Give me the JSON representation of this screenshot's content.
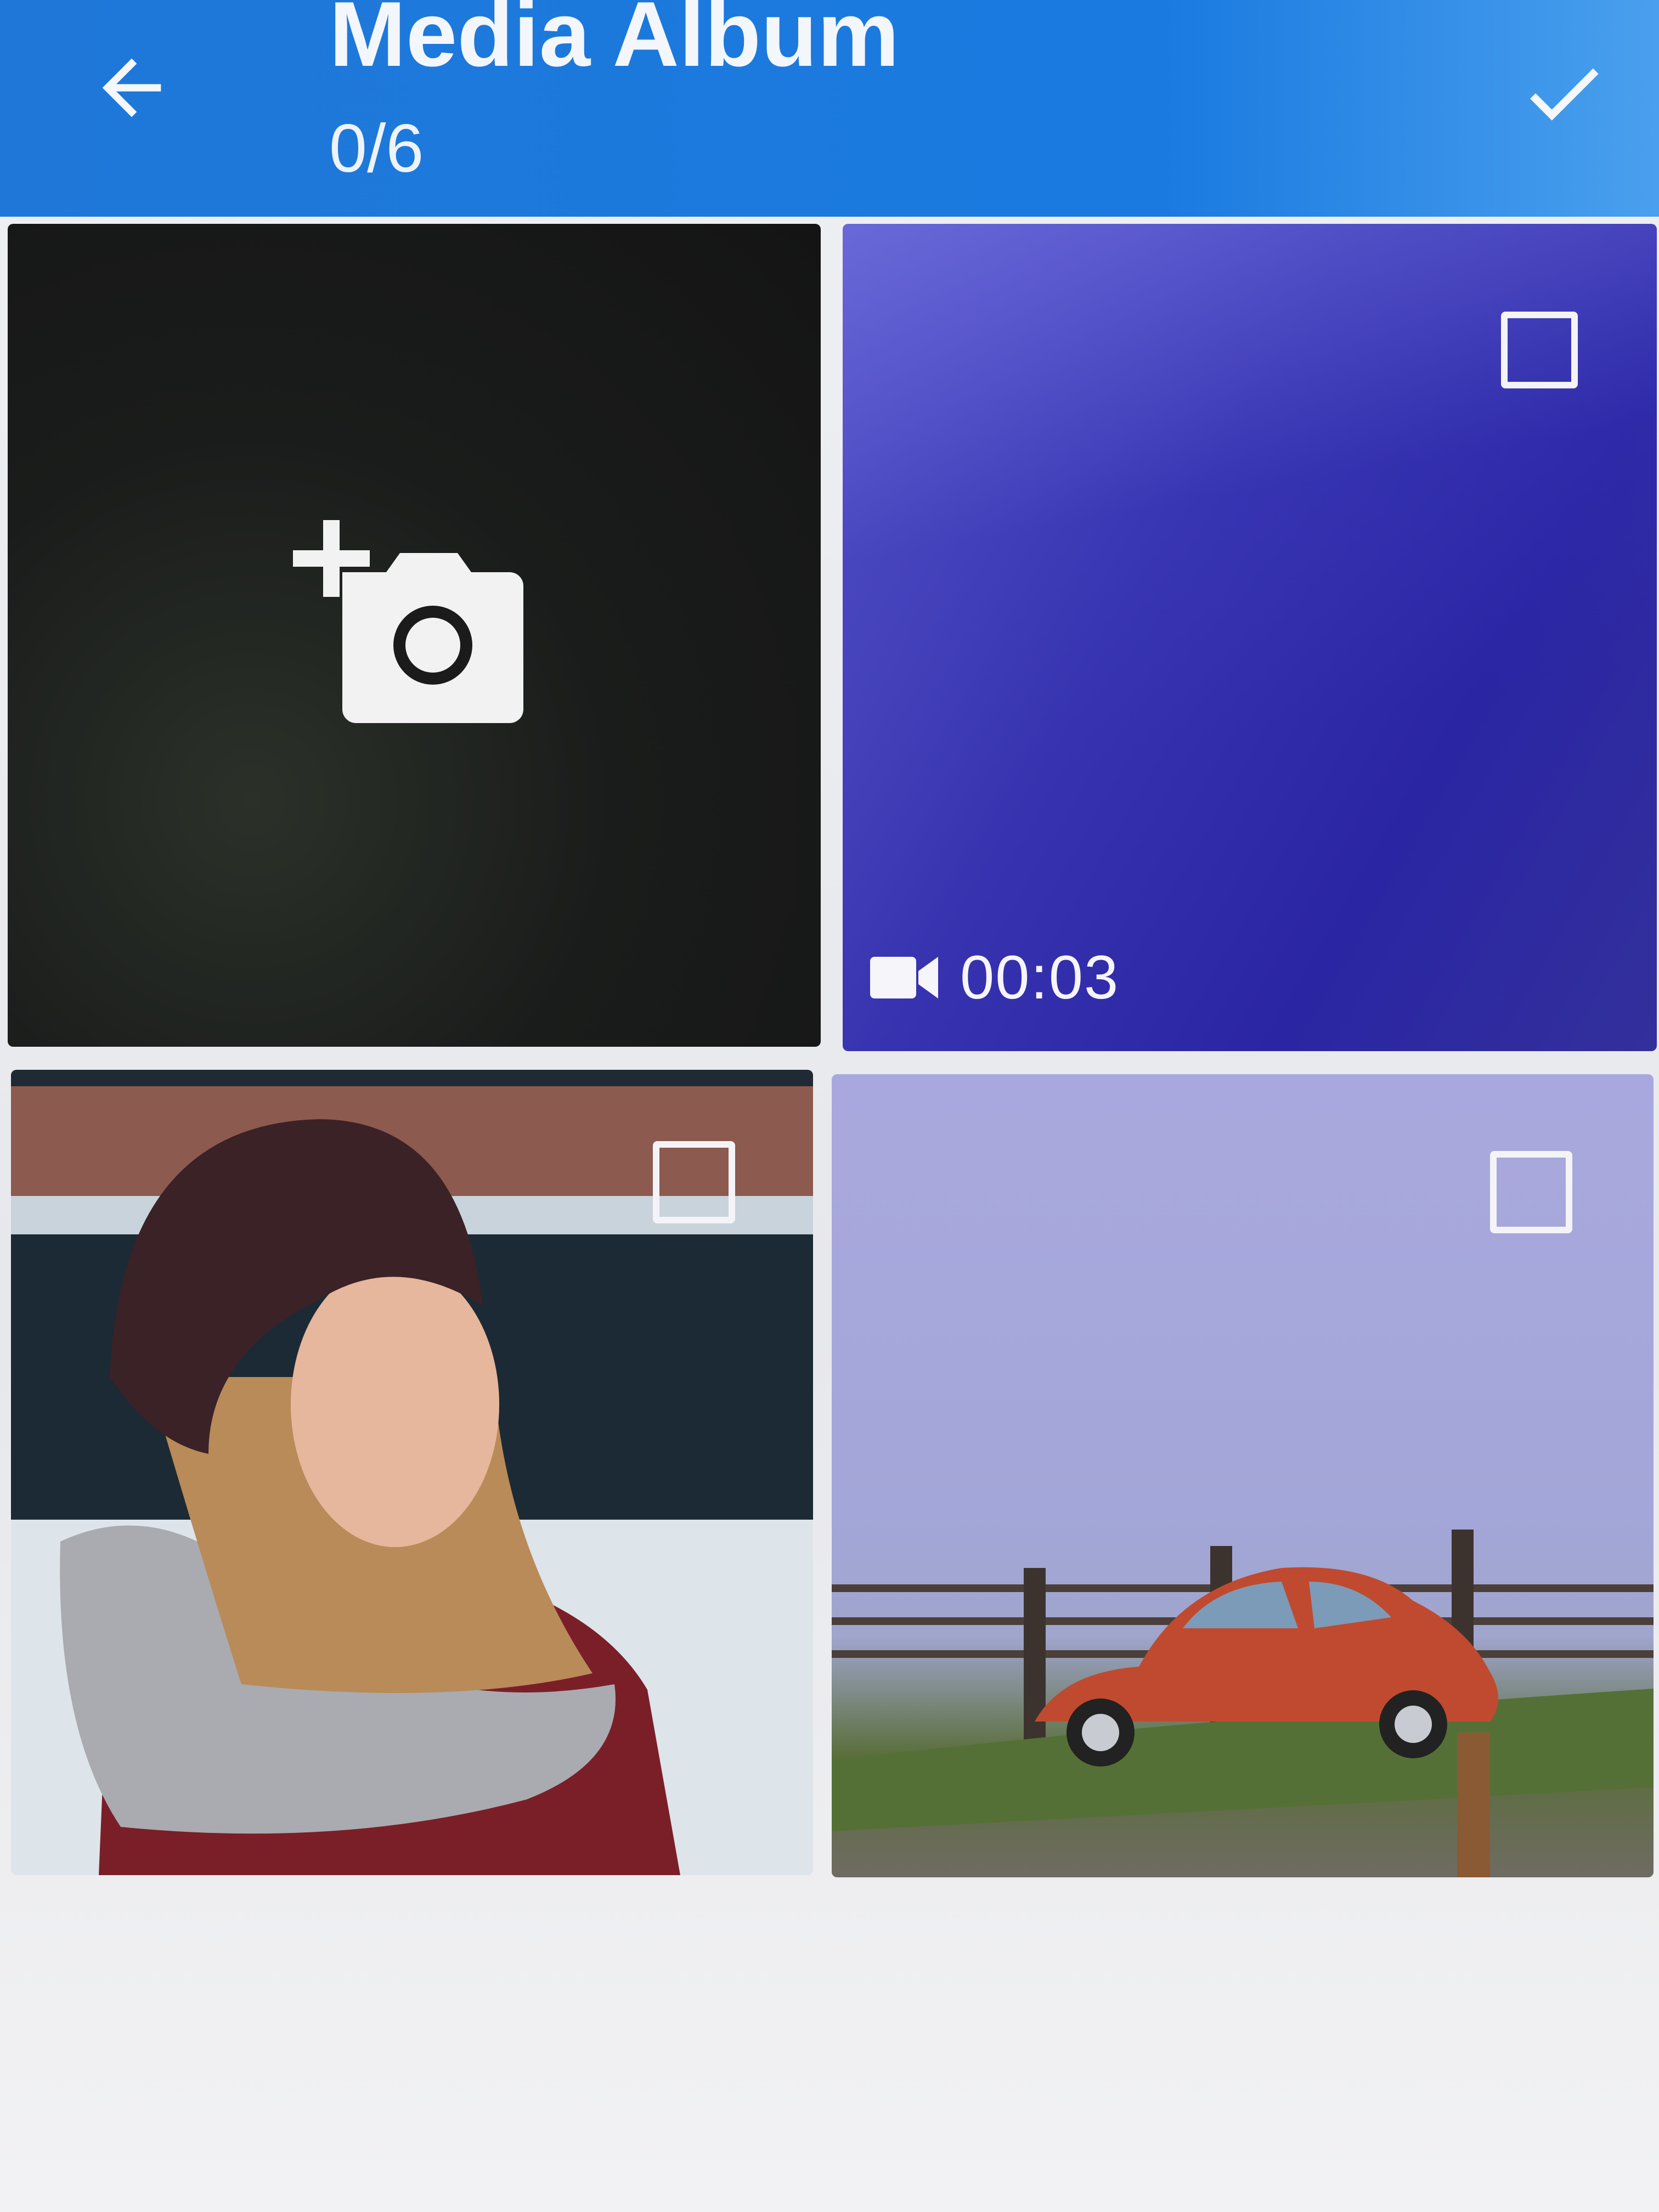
{
  "header": {
    "title": "Media Album",
    "count": "0/6",
    "back_icon": "arrow-left-icon",
    "confirm_icon": "checkmark-icon"
  },
  "grid": {
    "camera_tile": {
      "icon": "add-camera-icon"
    },
    "video_tile": {
      "icon": "video-camera-icon",
      "duration": "00:03",
      "selected": false
    },
    "portrait_tile": {
      "selected": false
    },
    "car_tile": {
      "selected": false
    }
  },
  "colors": {
    "app_bar": "#1f78d8",
    "header_text": "#f3f6fb",
    "checkbox_border": "#f4f4f8"
  }
}
